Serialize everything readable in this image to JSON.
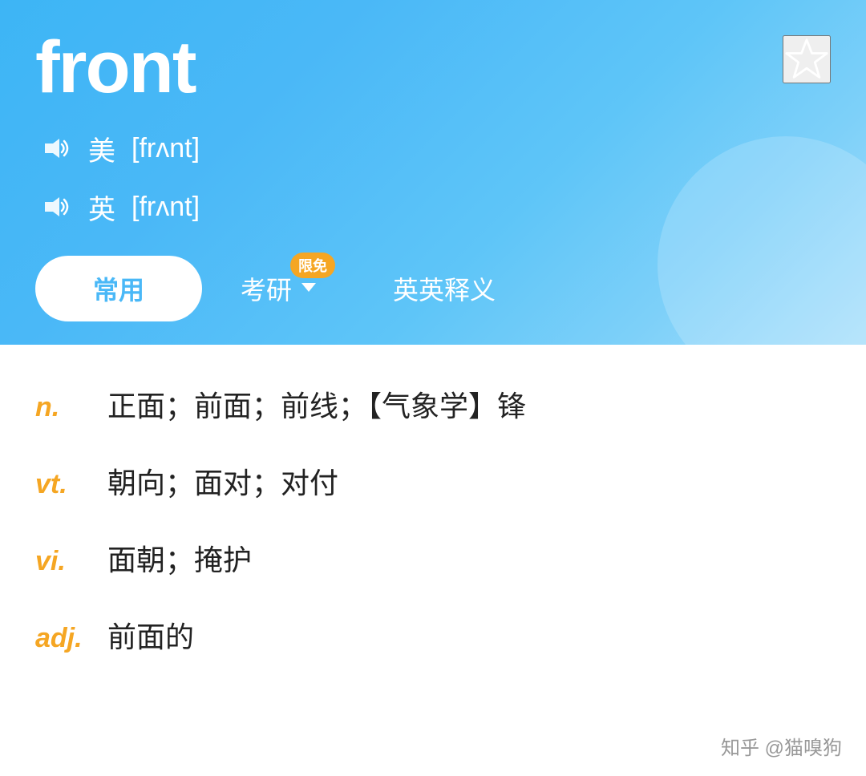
{
  "header": {
    "word": "front",
    "star_label": "star",
    "pronunciations": [
      {
        "region": "美",
        "ipa": "[frʌnt]",
        "speaker_label": "us-speaker"
      },
      {
        "region": "英",
        "ipa": "[frʌnt]",
        "speaker_label": "uk-speaker"
      }
    ],
    "tabs": [
      {
        "id": "common",
        "label": "常用",
        "active": true,
        "badge": null
      },
      {
        "id": "exam",
        "label": "考研",
        "active": false,
        "badge": "限免",
        "has_dropdown": true
      },
      {
        "id": "english",
        "label": "英英释义",
        "active": false,
        "badge": null
      }
    ]
  },
  "definitions": [
    {
      "pos": "n.",
      "text": "正面；前面；前线；【气象学】锋"
    },
    {
      "pos": "vt.",
      "text": "朝向；面对；对付"
    },
    {
      "pos": "vi.",
      "text": "面朝；掩护"
    },
    {
      "pos": "adj.",
      "text": "前面的"
    }
  ],
  "watermark": "知乎 @猫嗅狗",
  "colors": {
    "header_gradient_start": "#3db5f5",
    "header_gradient_end": "#a8dffb",
    "tab_active_text": "#4ab8f7",
    "badge_color": "#f5a623",
    "pos_color": "#f5a623"
  }
}
